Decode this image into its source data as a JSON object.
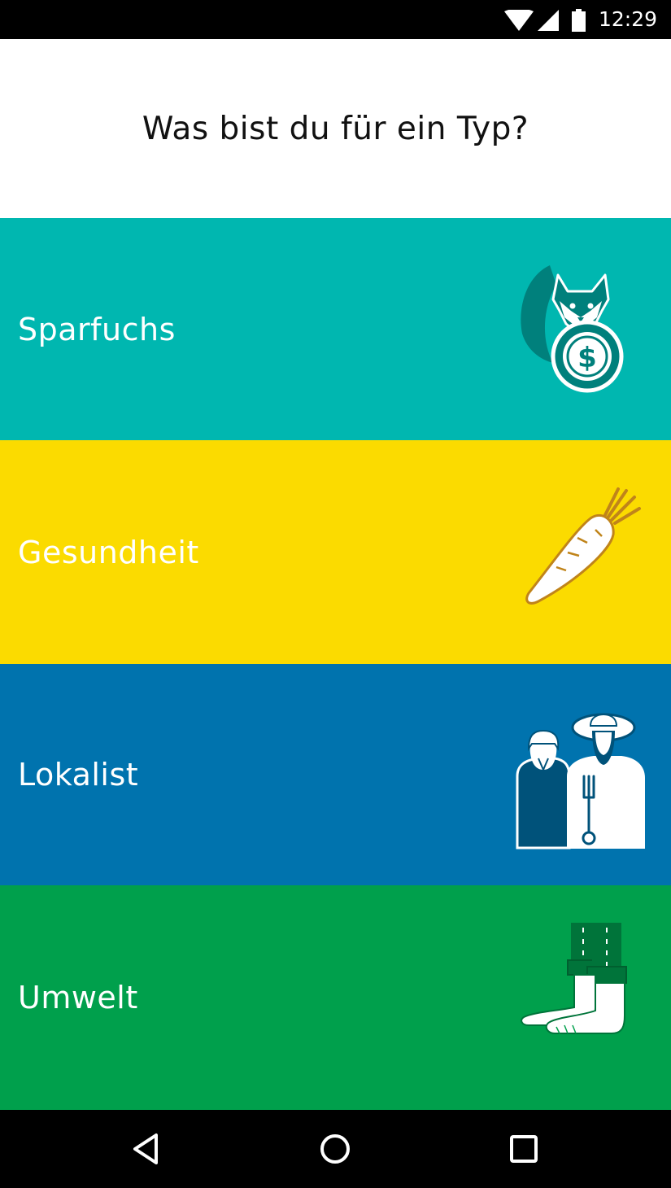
{
  "status_bar": {
    "time": "12:29",
    "icons": [
      "wifi-icon",
      "signal-icon",
      "battery-icon"
    ]
  },
  "header": {
    "title": "Was bist du für ein Typ?"
  },
  "categories": [
    {
      "label": "Sparfuchs",
      "icon": "fox-coin-icon",
      "color": "#00b7b0"
    },
    {
      "label": "Gesundheit",
      "icon": "carrot-icon",
      "color": "#fbdb00"
    },
    {
      "label": "Lokalist",
      "icon": "farmers-icon",
      "color": "#0073ae"
    },
    {
      "label": "Umwelt",
      "icon": "bare-feet-icon",
      "color": "#00a04c"
    }
  ],
  "nav_bar": {
    "buttons": [
      "back-icon",
      "home-icon",
      "recents-icon"
    ]
  }
}
